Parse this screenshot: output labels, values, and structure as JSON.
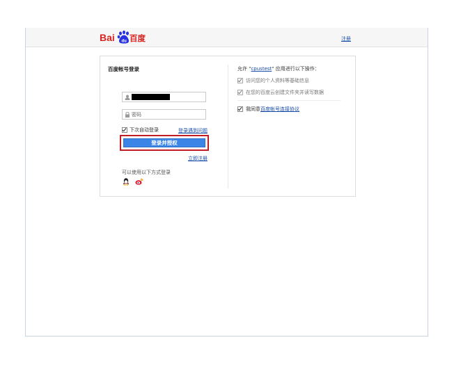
{
  "header": {
    "logo_text": "Bai百度",
    "register_link": "注册",
    "colors": {
      "logo_red": "#d6221f",
      "logo_blue": "#2932e1"
    }
  },
  "login": {
    "title": "百度帐号登录",
    "username_value": "",
    "password_placeholder": "密码",
    "remember_label": "下次自动登录",
    "remember_checked": true,
    "trouble_link": "登录遇到问题",
    "submit_label": "登录并授权",
    "register_now": "立即注册",
    "alt_login_label": "可以使用以下方式登录",
    "social": [
      "qq-icon",
      "weibo-icon"
    ]
  },
  "authorize": {
    "prefix": "允许 \"",
    "app_name": "cpustest",
    "suffix": "\" 应用进行以下操作：",
    "permissions": [
      {
        "label": "访问您的个人资料等基础信息",
        "checked": true,
        "disabled": true
      },
      {
        "label": "在您的百度云创建文件夹并读写数据",
        "checked": true,
        "disabled": true
      }
    ],
    "agree_prefix": "我同意",
    "agree_link": "百度帐号连接协议",
    "agree_checked": true
  },
  "colors": {
    "accent": "#3b85e6",
    "link": "#1a4ea8",
    "highlight": "#c21b21"
  }
}
